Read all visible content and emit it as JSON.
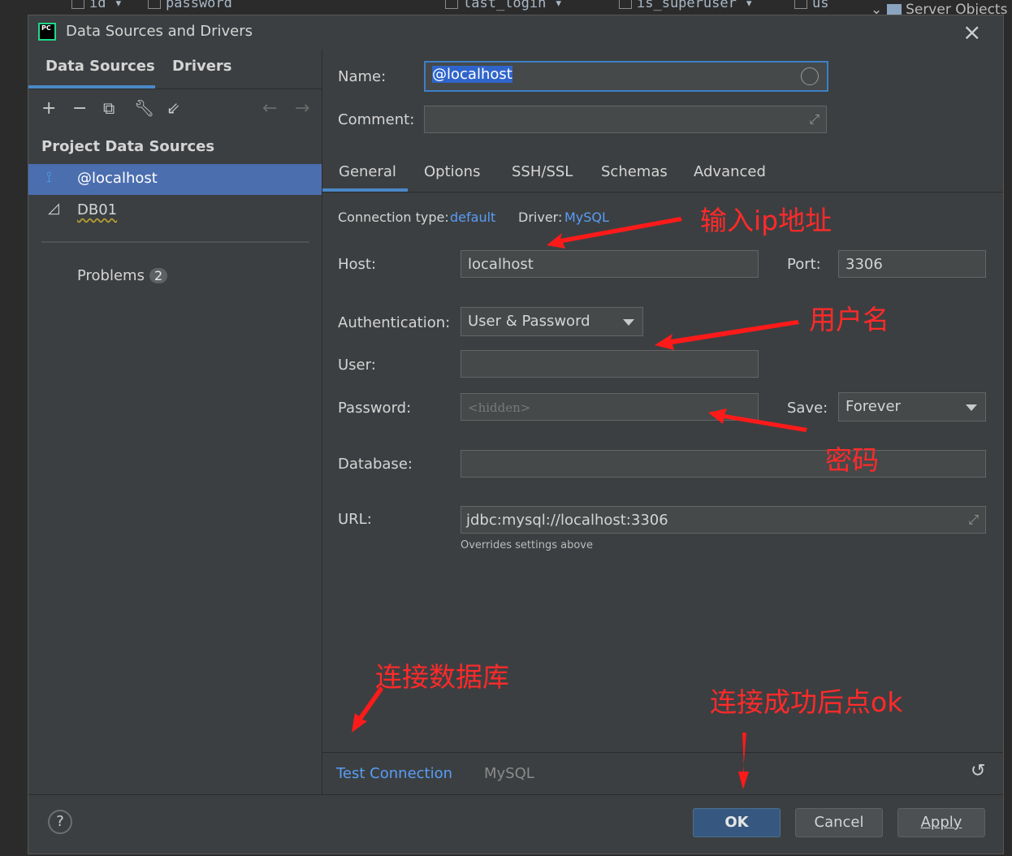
{
  "background": {
    "columns": [
      "id",
      "password",
      "last_login",
      "is_superuser",
      "us"
    ],
    "server_objects": "Server Objects"
  },
  "dialog": {
    "title": "Data Sources and Drivers",
    "app_icon_text": "PC"
  },
  "left": {
    "tabs": [
      "Data Sources",
      "Drivers"
    ],
    "section_title": "Project Data Sources",
    "items": [
      "@localhost",
      "DB01"
    ],
    "problems_label": "Problems",
    "problems_count": "2"
  },
  "form": {
    "name_label": "Name:",
    "name_value": "@localhost",
    "comment_label": "Comment:",
    "comment_value": "",
    "tabs": [
      "General",
      "Options",
      "SSH/SSL",
      "Schemas",
      "Advanced"
    ],
    "connection_type_label": "Connection type:",
    "connection_type_value": "default",
    "driver_label": "Driver:",
    "driver_value": "MySQL",
    "host_label": "Host:",
    "host_value": "localhost",
    "port_label": "Port:",
    "port_value": "3306",
    "auth_label": "Authentication:",
    "auth_value": "User & Password",
    "user_label": "User:",
    "user_value": "",
    "password_label": "Password:",
    "password_placeholder": "<hidden>",
    "save_label": "Save:",
    "save_value": "Forever",
    "database_label": "Database:",
    "database_value": "",
    "url_label": "URL:",
    "url_value": "jdbc:mysql://localhost:3306",
    "url_hint": "Overrides settings above"
  },
  "footer": {
    "test_connection": "Test Connection",
    "driver_name": "MySQL"
  },
  "buttons": {
    "help": "?",
    "ok": "OK",
    "cancel": "Cancel",
    "apply": "Apply"
  },
  "annotations": {
    "ip": "输入ip地址",
    "user": "用户名",
    "password": "密码",
    "test": "连接数据库",
    "ok": "连接成功后点ok"
  },
  "colors": {
    "dialog_bg": "#3c3f41",
    "selection": "#4b6eaf",
    "accent": "#4a88c7",
    "link": "#589df6",
    "annotation": "#ff2a2a"
  }
}
